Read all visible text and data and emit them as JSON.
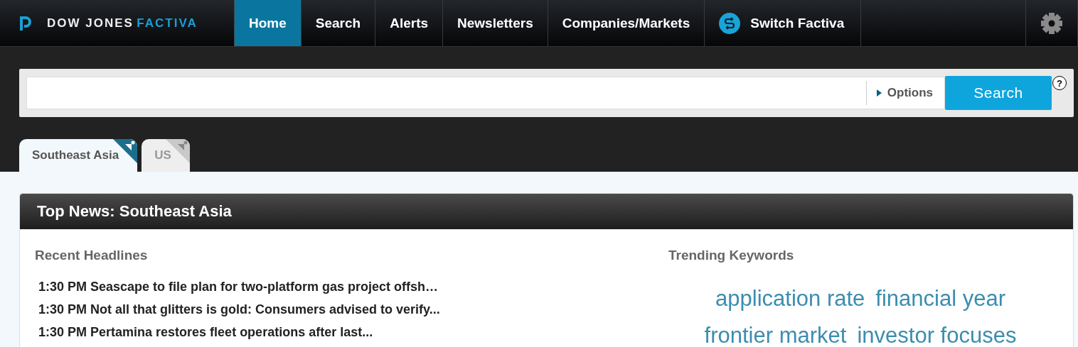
{
  "brand": {
    "name": "DOW JONES",
    "product": "FACTIVA"
  },
  "nav": [
    {
      "label": "Home",
      "selected": true,
      "kind": "plain"
    },
    {
      "label": "Search",
      "selected": false,
      "kind": "plain"
    },
    {
      "label": "Alerts",
      "selected": false,
      "kind": "plain"
    },
    {
      "label": "Newsletters",
      "selected": false,
      "kind": "plain"
    },
    {
      "label": "Companies/Markets",
      "selected": false,
      "kind": "plain"
    },
    {
      "label": "Switch Factiva",
      "selected": false,
      "kind": "switch"
    }
  ],
  "search": {
    "options": "Options",
    "button": "Search",
    "help": "?"
  },
  "tabs": [
    {
      "label": "Southeast Asia",
      "selected": true
    },
    {
      "label": "US",
      "selected": false
    }
  ],
  "card": {
    "title": "Top News: Southeast Asia",
    "headlines_title": "Recent Headlines",
    "headlines": [
      {
        "time": "1:30 PM",
        "title": "Seascape to file plan for two-platform gas project offsh…"
      },
      {
        "time": "1:30 PM",
        "title": "Not all that glitters is gold: Consumers advised to verify..."
      },
      {
        "time": "1:30 PM",
        "title": "Pertamina restores fleet operations after last..."
      }
    ],
    "keywords_title": "Trending Keywords",
    "keywords": [
      "application rate",
      "financial year",
      "frontier market",
      "investor focuses"
    ]
  }
}
